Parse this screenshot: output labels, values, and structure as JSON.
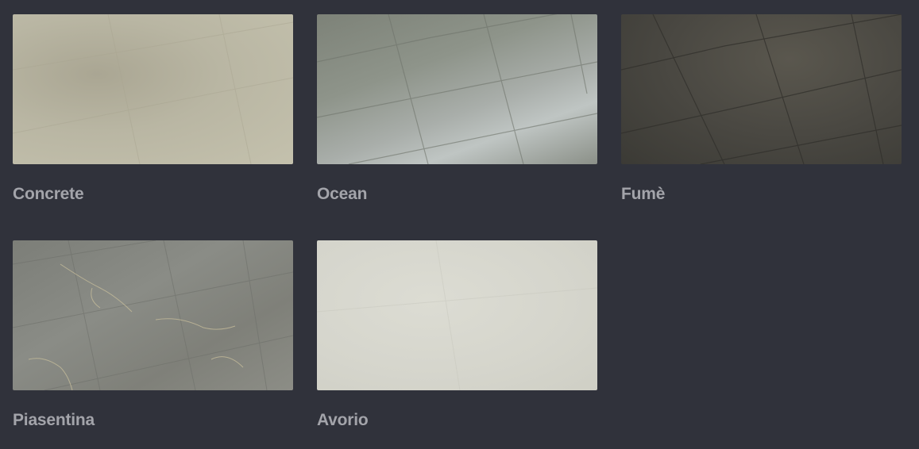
{
  "gallery": {
    "items": [
      {
        "label": "Concrete",
        "texture": "concrete-tile-texture",
        "color": "#bab6a3"
      },
      {
        "label": "Ocean",
        "texture": "ocean-tile-texture",
        "color": "#8e948a"
      },
      {
        "label": "Fumè",
        "texture": "fume-tile-texture",
        "color": "#4a4842"
      },
      {
        "label": "Piasentina",
        "texture": "piasentina-marble-texture",
        "color": "#838580"
      },
      {
        "label": "Avorio",
        "texture": "avorio-tile-texture",
        "color": "#d6d6cd"
      }
    ],
    "label_color": "#a3a4aa",
    "background_color": "#30323b"
  }
}
